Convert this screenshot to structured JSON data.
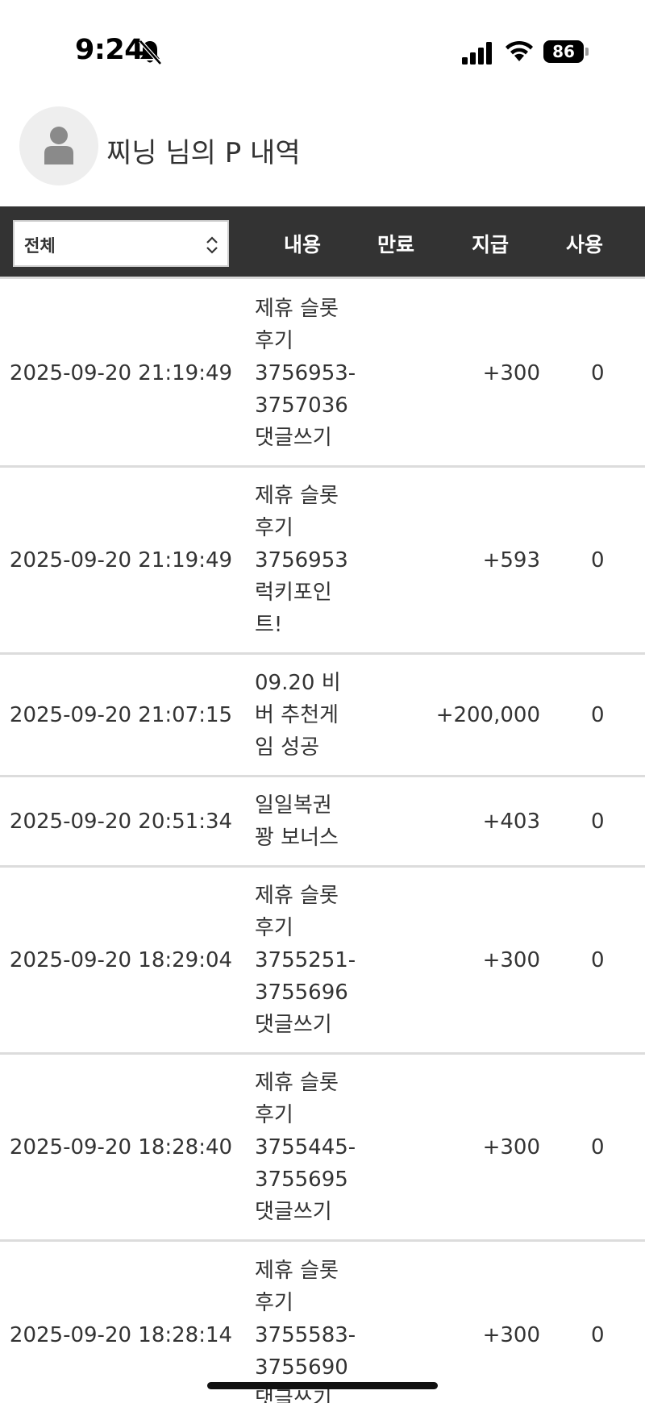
{
  "status_bar": {
    "time": "9:24",
    "battery": "86",
    "icons": [
      "bell-slash-icon",
      "signal-icon",
      "wifi-icon",
      "battery-icon"
    ]
  },
  "header": {
    "title": "찌닝 님의 P 내역",
    "avatar_icon": "user-icon"
  },
  "table": {
    "filter": {
      "selected": "전체",
      "icon": "updown-chevron-icon"
    },
    "columns": {
      "content": "내용",
      "expire": "만료",
      "give": "지급",
      "use": "사용"
    },
    "rows": [
      {
        "date": "2025-09-20 21:19:49",
        "content_lines": [
          "제휴 슬롯",
          "후기",
          "3756953-",
          "3757036",
          "댓글쓰기"
        ],
        "give": "+300",
        "use": "0"
      },
      {
        "date": "2025-09-20 21:19:49",
        "content_lines": [
          "제휴 슬롯",
          "후기",
          "3756953",
          "럭키포인",
          "트!"
        ],
        "give": "+593",
        "use": "0"
      },
      {
        "date": "2025-09-20 21:07:15",
        "content_lines": [
          "09.20 비",
          "버 추천게",
          "임 성공"
        ],
        "give": "+200,000",
        "use": "0"
      },
      {
        "date": "2025-09-20 20:51:34",
        "content_lines": [
          "일일복권",
          "꽝 보너스"
        ],
        "give": "+403",
        "use": "0"
      },
      {
        "date": "2025-09-20 18:29:04",
        "content_lines": [
          "제휴 슬롯",
          "후기",
          "3755251-",
          "3755696",
          "댓글쓰기"
        ],
        "give": "+300",
        "use": "0"
      },
      {
        "date": "2025-09-20 18:28:40",
        "content_lines": [
          "제휴 슬롯",
          "후기",
          "3755445-",
          "3755695",
          "댓글쓰기"
        ],
        "give": "+300",
        "use": "0"
      },
      {
        "date": "2025-09-20 18:28:14",
        "content_lines": [
          "제휴 슬롯",
          "후기",
          "3755583-",
          "3755690",
          "댓글쓰기"
        ],
        "give": "+300",
        "use": "0"
      }
    ]
  }
}
